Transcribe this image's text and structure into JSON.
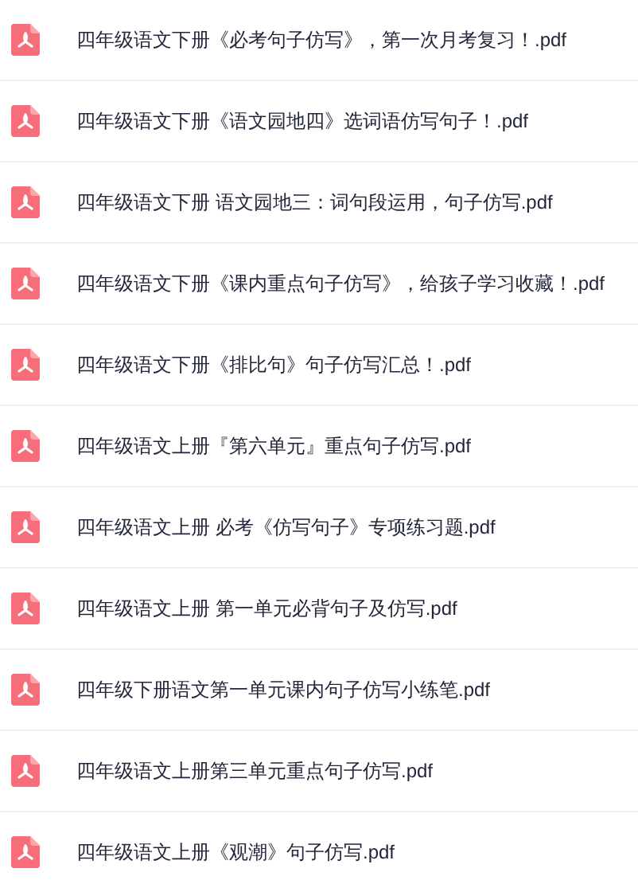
{
  "files": [
    {
      "name": "四年级语文下册《必考句子仿写》，第一次月考复习！.pdf"
    },
    {
      "name": "四年级语文下册《语文园地四》选词语仿写句子！.pdf"
    },
    {
      "name": "四年级语文下册 语文园地三：词句段运用，句子仿写.pdf"
    },
    {
      "name": "四年级语文下册《课内重点句子仿写》，给孩子学习收藏！.pdf"
    },
    {
      "name": "四年级语文下册《排比句》句子仿写汇总！.pdf"
    },
    {
      "name": "四年级语文上册『第六单元』重点句子仿写.pdf"
    },
    {
      "name": "四年级语文上册 必考《仿写句子》专项练习题.pdf"
    },
    {
      "name": "四年级语文上册 第一单元必背句子及仿写.pdf"
    },
    {
      "name": "四年级下册语文第一单元课内句子仿写小练笔.pdf"
    },
    {
      "name": "四年级语文上册第三单元重点句子仿写.pdf"
    },
    {
      "name": "四年级语文上册《观潮》句子仿写.pdf"
    }
  ]
}
